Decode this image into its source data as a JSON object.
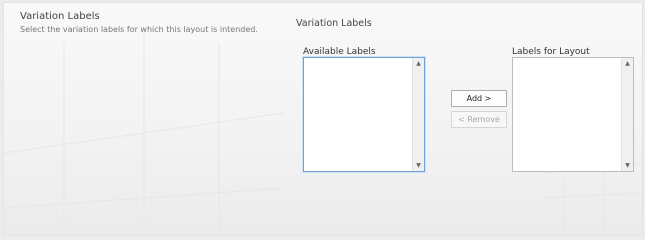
{
  "section": {
    "title": "Variation Labels",
    "description": "Select the variation labels for which this layout is intended."
  },
  "form": {
    "label": "Variation Labels",
    "available": {
      "caption": "Available Labels",
      "items": []
    },
    "selected": {
      "caption": "Labels for Layout",
      "items": []
    },
    "buttons": {
      "add": "Add >",
      "remove": "< Remove"
    }
  },
  "icons": {
    "scroll_up": "chevron-up-icon",
    "scroll_down": "chevron-down-icon"
  },
  "colors": {
    "focus_border": "#6ea3d8",
    "list_border": "#bdbdbd"
  }
}
